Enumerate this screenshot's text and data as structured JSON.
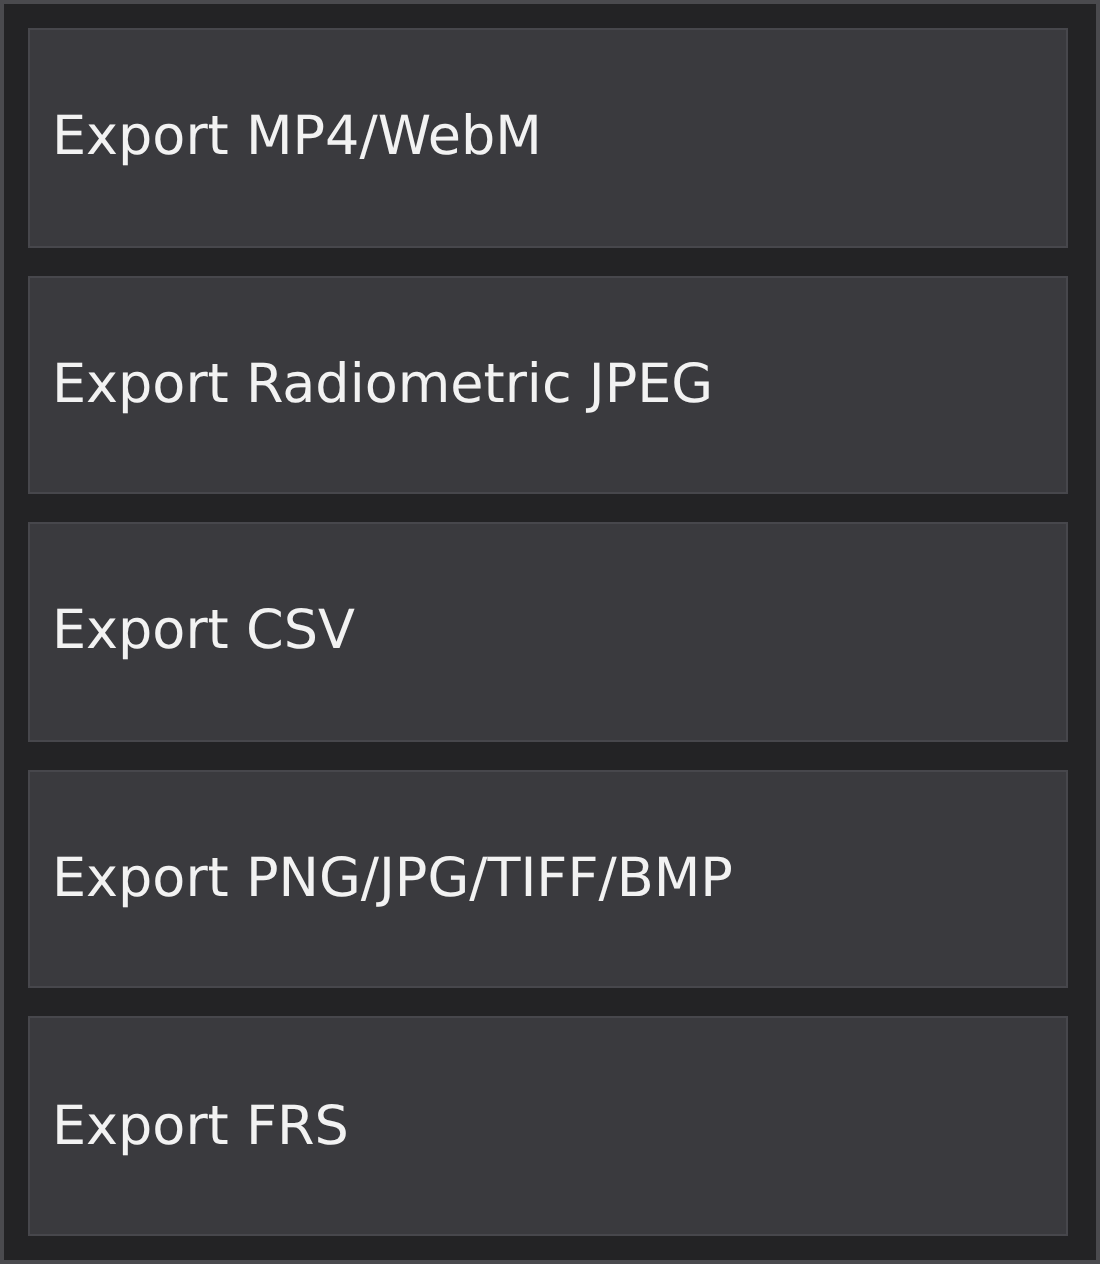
{
  "menu": {
    "items": [
      {
        "label": "Export MP4/WebM"
      },
      {
        "label": "Export Radiometric JPEG"
      },
      {
        "label": "Export CSV"
      },
      {
        "label": "Export PNG/JPG/TIFF/BMP"
      },
      {
        "label": "Export FRS"
      }
    ]
  }
}
